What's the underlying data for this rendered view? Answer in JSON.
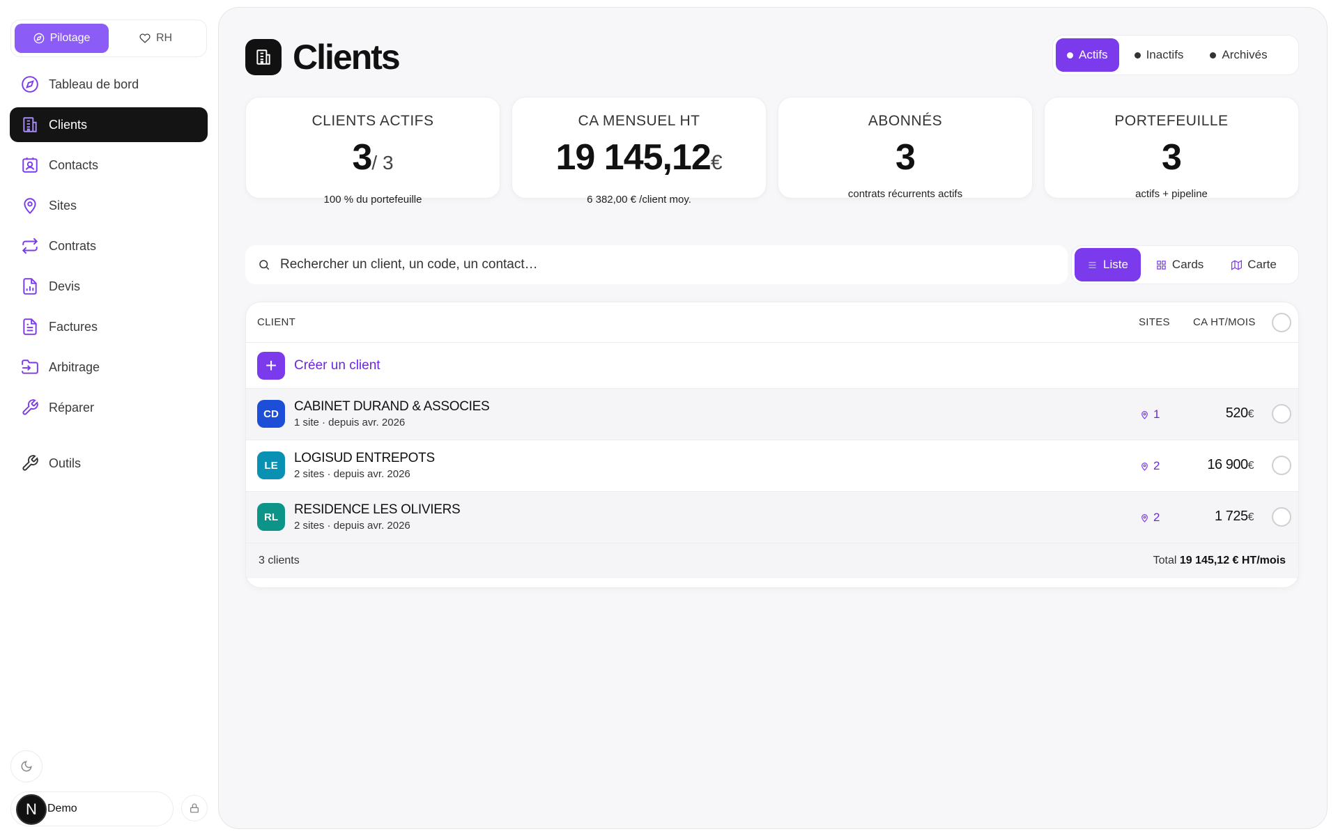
{
  "sidebar": {
    "modes": [
      {
        "label": "Pilotage",
        "icon": "compass-icon",
        "active": true
      },
      {
        "label": "RH",
        "icon": "heart-icon",
        "active": false
      }
    ],
    "items": [
      {
        "label": "Tableau de bord",
        "icon": "compass-icon"
      },
      {
        "label": "Clients",
        "icon": "building-icon",
        "active": true
      },
      {
        "label": "Contacts",
        "icon": "contact-card-icon"
      },
      {
        "label": "Sites",
        "icon": "map-pin-icon"
      },
      {
        "label": "Contrats",
        "icon": "repeat-icon"
      },
      {
        "label": "Devis",
        "icon": "chart-file-icon"
      },
      {
        "label": "Factures",
        "icon": "document-icon"
      },
      {
        "label": "Arbitrage",
        "icon": "folder-input-icon"
      },
      {
        "label": "Réparer",
        "icon": "wrench-icon"
      },
      {
        "label": "Outils",
        "icon": "wrench-icon"
      }
    ],
    "user": {
      "initial": "N",
      "name": "Demo"
    }
  },
  "header": {
    "title": "Clients",
    "status_tabs": [
      {
        "label": "Actifs",
        "active": true
      },
      {
        "label": "Inactifs",
        "active": false
      },
      {
        "label": "Archivés",
        "active": false
      }
    ]
  },
  "kpis": [
    {
      "label": "CLIENTS ACTIFS",
      "value": "3",
      "sub": "/ 3",
      "caption": "100 % du portefeuille"
    },
    {
      "label": "CA MENSUEL HT",
      "value": "19 145,12",
      "currency": "€",
      "caption": "6 382,00 € /client moy."
    },
    {
      "label": "ABONNÉS",
      "value": "3",
      "caption": "contrats récurrents actifs"
    },
    {
      "label": "PORTEFEUILLE",
      "value": "3",
      "caption": "actifs + pipeline"
    }
  ],
  "search": {
    "placeholder": "Rechercher un client, un code, un contact…"
  },
  "view_tabs": [
    {
      "label": "Liste",
      "icon": "list-icon",
      "active": true
    },
    {
      "label": "Cards",
      "icon": "grid-icon",
      "active": false
    },
    {
      "label": "Carte",
      "icon": "map-icon",
      "active": false
    }
  ],
  "table": {
    "columns": {
      "client": "CLIENT",
      "sites": "SITES",
      "ca": "CA HT/MOIS"
    },
    "create_label": "Créer un client",
    "rows": [
      {
        "initials": "CD",
        "color": "#1d4ed8",
        "name": "CABINET DURAND & ASSOCIES",
        "meta": "1 site · depuis avr. 2026",
        "sites": "1",
        "ca": "520",
        "currency": "€"
      },
      {
        "initials": "LE",
        "color": "#0891b2",
        "name": "LOGISUD ENTREPOTS",
        "meta": "2 sites · depuis avr. 2026",
        "sites": "2",
        "ca": "16 900",
        "currency": "€"
      },
      {
        "initials": "RL",
        "color": "#0d9488",
        "name": "RESIDENCE LES OLIVIERS",
        "meta": "2 sites · depuis avr. 2026",
        "sites": "2",
        "ca": "1 725",
        "currency": "€"
      }
    ],
    "footer": {
      "count": "3 clients",
      "total_label": "Total",
      "total_value": "19 145,12 € HT/mois"
    }
  },
  "colors": {
    "accent": "#7c3aed",
    "accent_light": "#8b5cf6",
    "dark": "#141414"
  }
}
